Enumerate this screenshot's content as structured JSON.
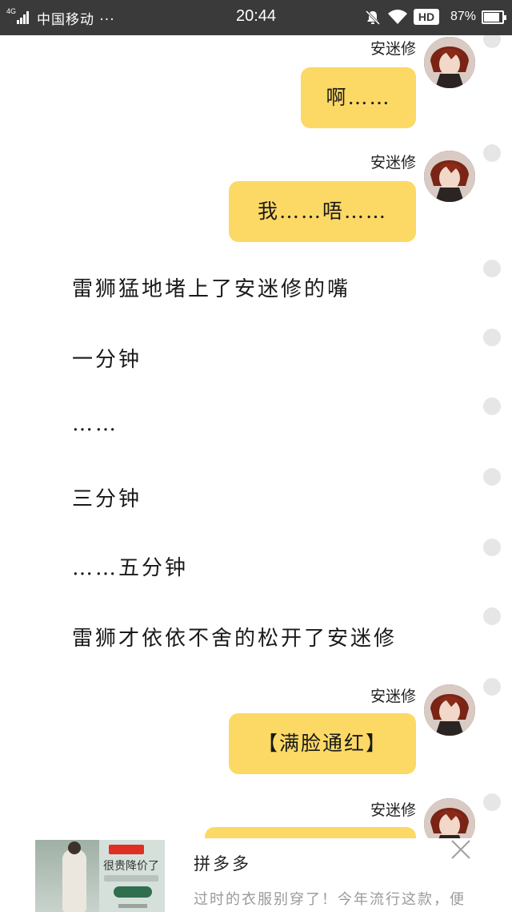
{
  "status_bar": {
    "network": "4G",
    "carrier": "中国移动 ···",
    "time": "20:44",
    "hd": "HD",
    "battery": "87%",
    "battery_level": 0.87
  },
  "chat": {
    "speaker": "安迷修",
    "messages": [
      {
        "type": "bubble",
        "text": "啊……"
      },
      {
        "type": "bubble",
        "text": "我……唔……"
      },
      {
        "type": "narration",
        "text": "雷狮猛地堵上了安迷修的嘴"
      },
      {
        "type": "narration",
        "text": "一分钟"
      },
      {
        "type": "narration",
        "text": "……"
      },
      {
        "type": "narration",
        "text": "三分钟"
      },
      {
        "type": "narration",
        "text": "……五分钟"
      },
      {
        "type": "narration",
        "text": "雷狮才依依不舍的松开了安迷修"
      },
      {
        "type": "bubble",
        "text": "【满脸通红】"
      },
      {
        "type": "bubble",
        "text": ""
      }
    ]
  },
  "ad": {
    "brand": "拼多多",
    "description": "过时的衣服别穿了！今年流行这款，便",
    "promo_text": "很贵降价了",
    "close_icon": "close-icon"
  },
  "colors": {
    "status_bar": "#3a3a3a",
    "bubble": "#fcd965",
    "dot": "#e6e6e6"
  }
}
